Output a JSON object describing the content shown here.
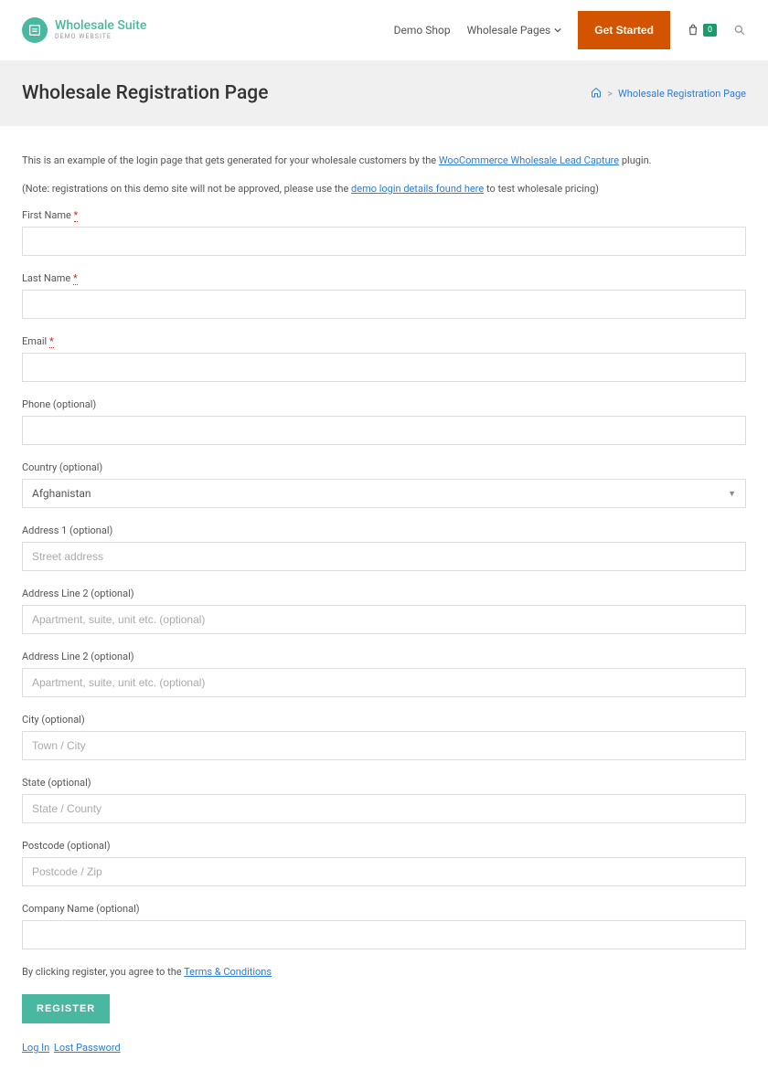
{
  "logo": {
    "title": "Wholesale Suite",
    "subtitle": "DEMO WEBSITE"
  },
  "nav": {
    "demo_shop": "Demo Shop",
    "wholesale_pages": "Wholesale Pages",
    "get_started": "Get Started",
    "cart_count": "0"
  },
  "titlebar": {
    "title": "Wholesale Registration Page",
    "breadcrumb_sep": ">",
    "breadcrumb_current": "Wholesale Registration Page"
  },
  "intro": {
    "line1_pre": "This is an example of the login page that gets generated for your wholesale customers by the ",
    "line1_link": "WooCommerce Wholesale Lead Capture",
    "line1_post": " plugin.",
    "line2_pre": "(Note: registrations on this demo site will not be approved, please use the ",
    "line2_link": "demo login details found here",
    "line2_post": " to test wholesale pricing)"
  },
  "fields": {
    "first_name": {
      "label": "First Name ",
      "req": "*"
    },
    "last_name": {
      "label": "Last Name ",
      "req": "*"
    },
    "email": {
      "label": "Email ",
      "req": "*"
    },
    "phone": {
      "label": "Phone (optional)"
    },
    "country": {
      "label": "Country (optional)",
      "value": "Afghanistan"
    },
    "address1": {
      "label": "Address 1 (optional)",
      "placeholder": "Street address"
    },
    "address2a": {
      "label": "Address Line 2 (optional)",
      "placeholder": "Apartment, suite, unit etc. (optional)"
    },
    "address2b": {
      "label": "Address Line 2 (optional)",
      "placeholder": "Apartment, suite, unit etc. (optional)"
    },
    "city": {
      "label": "City (optional)",
      "placeholder": "Town / City"
    },
    "state": {
      "label": "State (optional)",
      "placeholder": "State / County"
    },
    "postcode": {
      "label": "Postcode (optional)",
      "placeholder": "Postcode / Zip"
    },
    "company": {
      "label": "Company Name (optional)"
    }
  },
  "agree": {
    "pre": "By clicking register, you agree to the ",
    "link": "Terms & Conditions"
  },
  "buttons": {
    "register": "REGISTER"
  },
  "aux": {
    "login": "Log In",
    "lost": "Lost Password"
  }
}
